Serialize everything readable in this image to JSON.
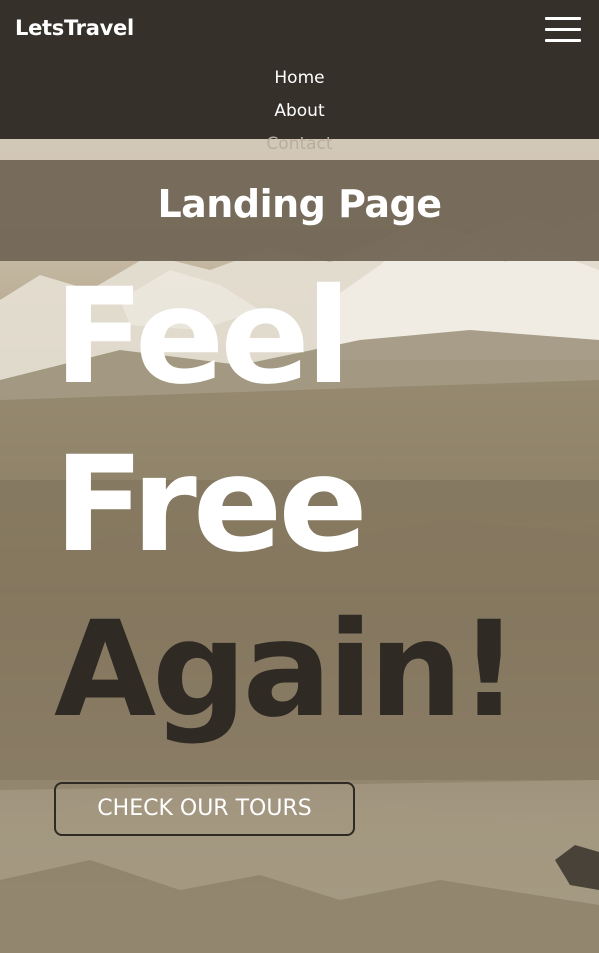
{
  "navbar": {
    "brand": "LetsTravel",
    "menu_icon": "hamburger-menu-icon",
    "items": [
      {
        "label": "Home"
      },
      {
        "label": "About"
      },
      {
        "label": "Contact"
      }
    ]
  },
  "landing": {
    "title": "Landing Page"
  },
  "hero": {
    "headline_line1": "Feel",
    "headline_line2": "Free",
    "headline_line3": "Again!",
    "cta_label": "CHECK OUR TOURS",
    "background": "mountain-forest-photo"
  },
  "colors": {
    "nav_bg": "#2f2a24",
    "band_bg": "#706454",
    "text_light": "#ffffff",
    "text_dark": "#2f2a24",
    "sepia": "#a89a82"
  }
}
